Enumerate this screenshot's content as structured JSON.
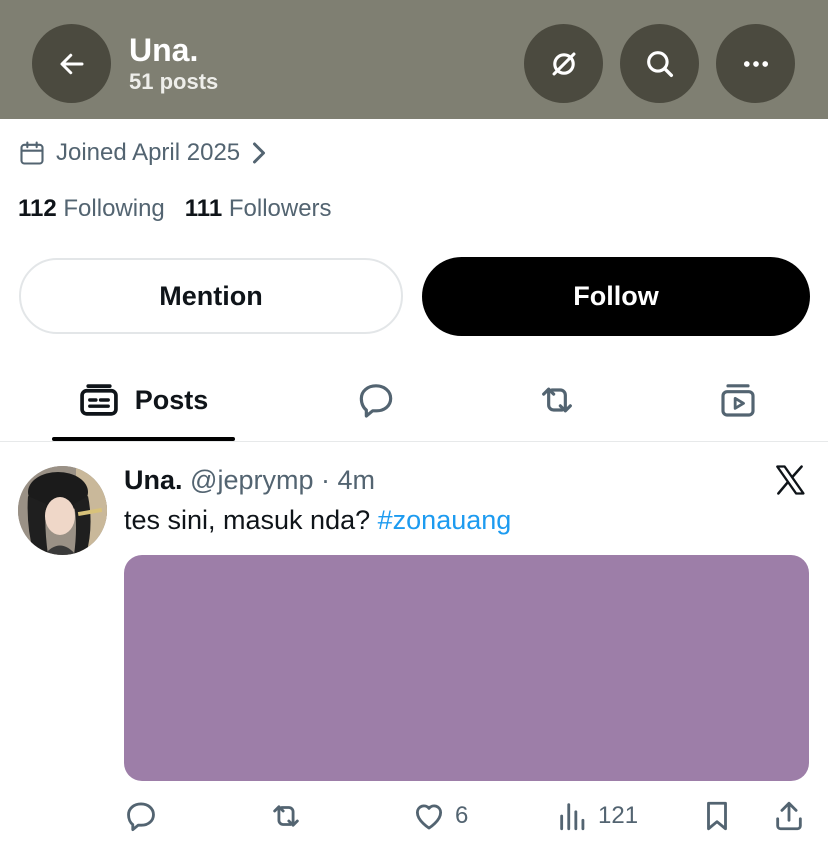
{
  "header": {
    "name": "Una.",
    "post_count": "51 posts",
    "background_color": "#7f7f72",
    "icons": [
      "arrow-left-icon",
      "grok-icon",
      "search-icon",
      "more-icon"
    ]
  },
  "profile": {
    "joined": "Joined April 2025",
    "following_count": "112",
    "following_label": "Following",
    "followers_count": "111",
    "followers_label": "Followers",
    "mention_label": "Mention",
    "follow_label": "Follow"
  },
  "tabs": [
    {
      "label": "Posts",
      "icon": "posts-icon",
      "active": true
    },
    {
      "label": "",
      "icon": "replies-icon"
    },
    {
      "label": "",
      "icon": "repost-icon"
    },
    {
      "label": "",
      "icon": "media-icon"
    }
  ],
  "post": {
    "name": "Una.",
    "handle": "@jeprymp",
    "separator": "·",
    "time": "4m",
    "text": "tes sini, masuk nda?",
    "hashtag": "#zonauang",
    "media_color": "#9d7ea8",
    "actions": {
      "replies": "",
      "reposts": "",
      "likes": "6",
      "views": "121"
    }
  },
  "colors": {
    "accent_link": "#1d9bf0",
    "muted_text": "#536471",
    "follow_button": "#000000"
  }
}
